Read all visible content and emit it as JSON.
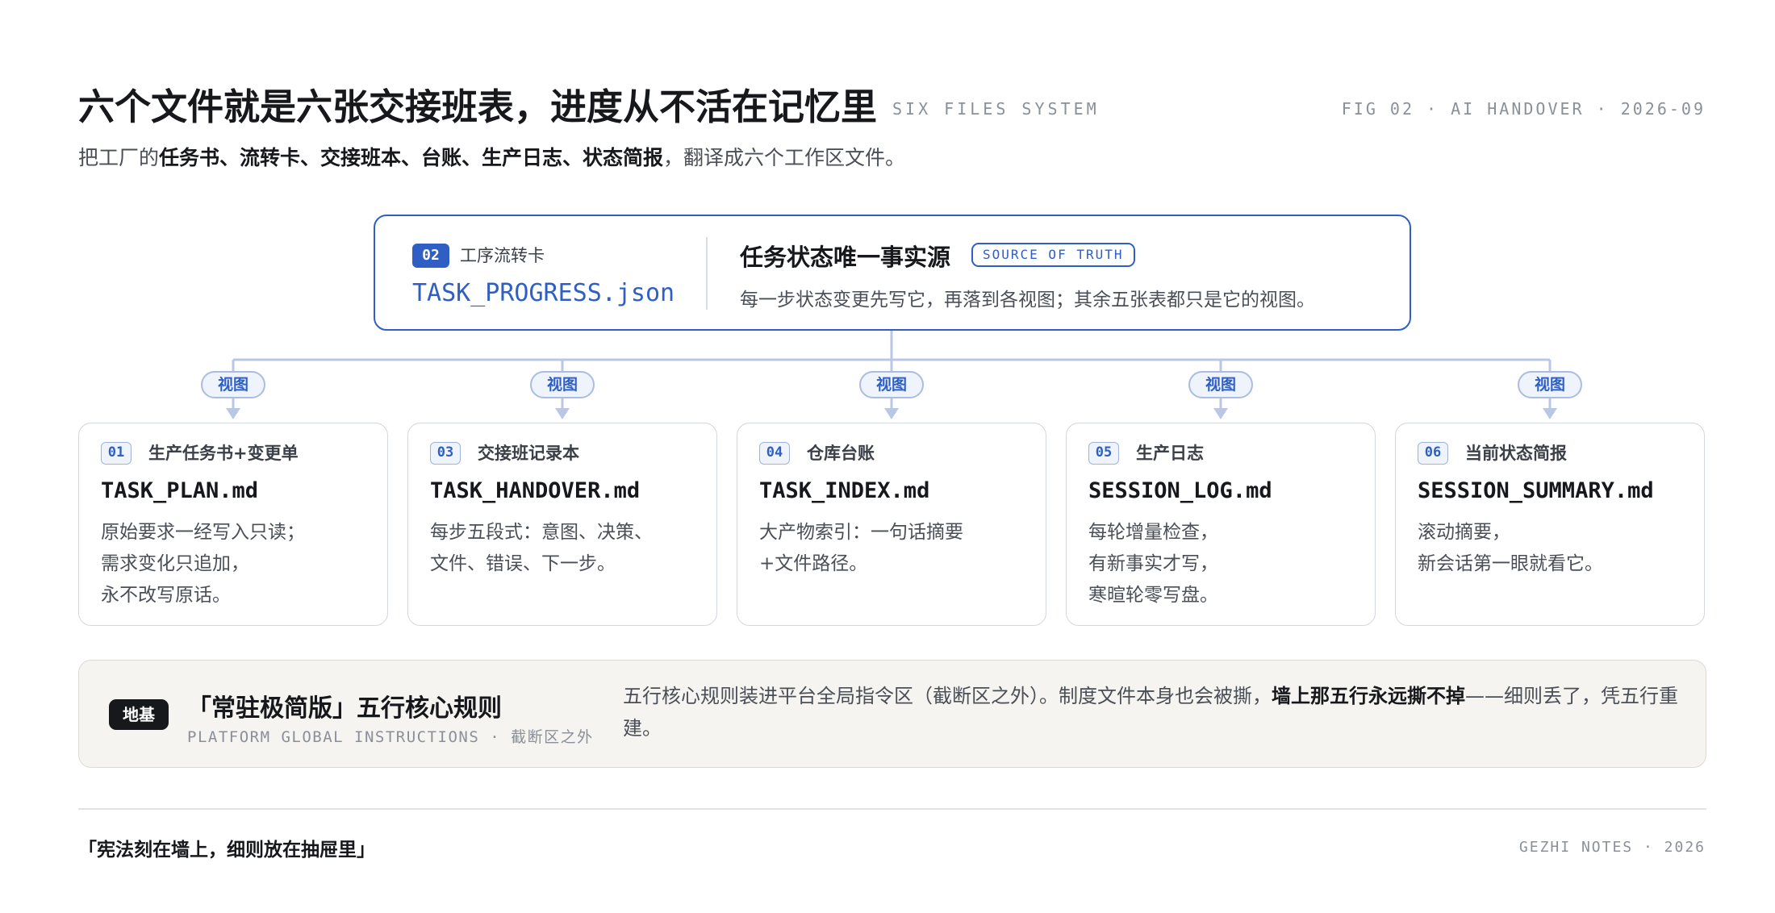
{
  "header": {
    "title": "六个文件就是六张交接班表，进度从不活在记忆里",
    "title_en": "SIX FILES SYSTEM",
    "fig_tag": "FIG 02 · AI HANDOVER · 2026-09",
    "subtitle_prefix": "把工厂的",
    "subtitle_bold": "任务书、流转卡、交接班本、台账、生产日志、状态简报",
    "subtitle_suffix": "，翻译成六个工作区文件。"
  },
  "source_of_truth": {
    "num": "02",
    "label": "工序流转卡",
    "file": "TASK_PROGRESS.json",
    "heading": "任务状态唯一事实源",
    "badge": "SOURCE OF TRUTH",
    "description": "每一步状态变更先写它，再落到各视图；其余五张表都只是它的视图。"
  },
  "view_label": "视图",
  "cards": [
    {
      "num": "01",
      "label": "生产任务书+变更单",
      "file": "TASK_PLAN.md",
      "lines": [
        "原始要求一经写入只读；",
        "需求变化只追加，",
        "永不改写原话。"
      ]
    },
    {
      "num": "03",
      "label": "交接班记录本",
      "file": "TASK_HANDOVER.md",
      "lines": [
        "每步五段式：意图、决策、",
        "文件、错误、下一步。"
      ]
    },
    {
      "num": "04",
      "label": "仓库台账",
      "file": "TASK_INDEX.md",
      "lines": [
        "大产物索引：一句话摘要",
        "+文件路径。"
      ]
    },
    {
      "num": "05",
      "label": "生产日志",
      "file": "SESSION_LOG.md",
      "lines": [
        "每轮增量检查，",
        "有新事实才写，",
        "寒暄轮零写盘。"
      ]
    },
    {
      "num": "06",
      "label": "当前状态简报",
      "file": "SESSION_SUMMARY.md",
      "lines": [
        "滚动摘要，",
        "新会话第一眼就看它。"
      ]
    }
  ],
  "foundation": {
    "tag": "地基",
    "heading": "「常驻极简版」五行核心规则",
    "sub": "PLATFORM GLOBAL INSTRUCTIONS · 截断区之外",
    "text_prefix": "五行核心规则装进平台全局指令区（截断区之外）。制度文件本身也会被撕，",
    "text_bold": "墙上那五行永远撕不掉",
    "text_suffix": "——细则丢了，凭五行重建。"
  },
  "footer": {
    "quote": "「宪法刻在墙上，细则放在抽屉里」",
    "credit": "GEZHI NOTES · 2026"
  },
  "colors": {
    "accent": "#2f5fc4",
    "connector": "#b9c7e4",
    "text": "#16181c",
    "muted": "#8a9099"
  }
}
